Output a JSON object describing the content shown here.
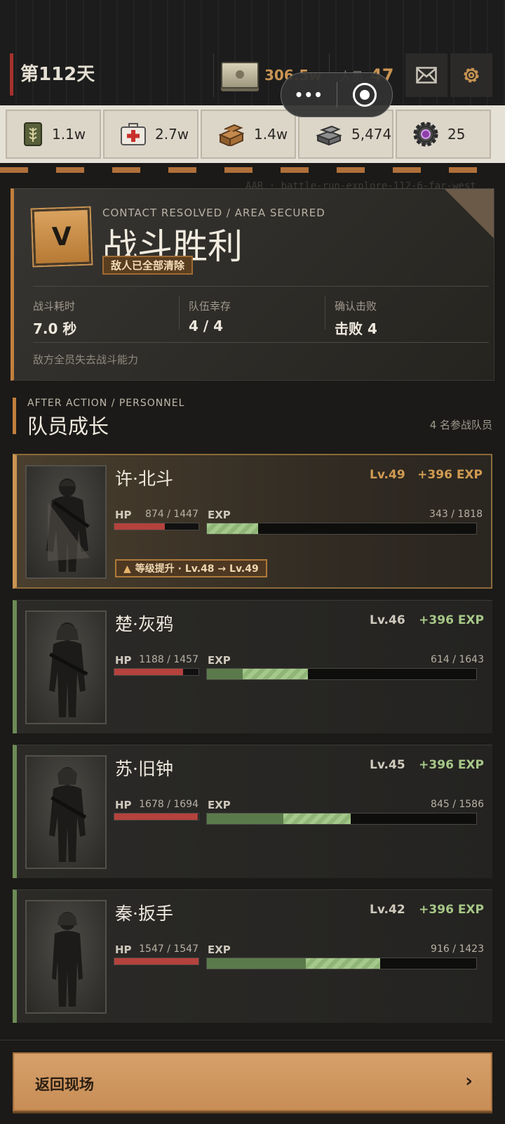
{
  "header": {
    "day": "第112天",
    "money": "306.5w",
    "personnel_label": "人员",
    "personnel_value": "47",
    "capsule_more": "•••"
  },
  "resources": [
    {
      "icon": "grain-can-icon",
      "value": "1.1w"
    },
    {
      "icon": "medkit-icon",
      "value": "2.7w"
    },
    {
      "icon": "wood-planks-icon",
      "value": "1.4w"
    },
    {
      "icon": "steel-ingots-icon",
      "value": "5,474"
    },
    {
      "icon": "gear-core-icon",
      "value": "25"
    }
  ],
  "log_ghost": "AAR · battle-run-explore-112-6-far-west",
  "victory": {
    "badge": "V",
    "subtitle_en": "CONTACT RESOLVED / AREA SECURED",
    "title": "战斗胜利",
    "tag": "敌人已全部清除",
    "stats": [
      {
        "label": "战斗耗时",
        "value": "7.0 秒"
      },
      {
        "label": "队伍幸存",
        "value": "4 / 4"
      },
      {
        "label": "确认击败",
        "value": "击败 4"
      }
    ],
    "note": "敌方全员失去战斗能力"
  },
  "personnel_section": {
    "subtitle_en": "AFTER ACTION / PERSONNEL",
    "title": "队员成长",
    "count": "4 名参战队员"
  },
  "squad": [
    {
      "name": "许·北斗",
      "level": "Lv.49",
      "gain": "+396 EXP",
      "hp_label": "HP",
      "hp": "874 / 1447",
      "hp_ratio": 0.604,
      "exp_label": "EXP",
      "exp": "343 / 1818",
      "exp_ratio": 0.189,
      "exp_gain_ratio": 0.189,
      "levelup": "等级提升 · Lv.48 → Lv.49"
    },
    {
      "name": "楚·灰鸦",
      "level": "Lv.46",
      "gain": "+396 EXP",
      "hp_label": "HP",
      "hp": "1188 / 1457",
      "hp_ratio": 0.815,
      "exp_label": "EXP",
      "exp": "614 / 1643",
      "exp_ratio": 0.374,
      "exp_gain_ratio": 0.241
    },
    {
      "name": "苏·旧钟",
      "level": "Lv.45",
      "gain": "+396 EXP",
      "hp_label": "HP",
      "hp": "1678 / 1694",
      "hp_ratio": 0.991,
      "exp_label": "EXP",
      "exp": "845 / 1586",
      "exp_ratio": 0.533,
      "exp_gain_ratio": 0.25
    },
    {
      "name": "秦·扳手",
      "level": "Lv.42",
      "gain": "+396 EXP",
      "hp_label": "HP",
      "hp": "1547 / 1547",
      "hp_ratio": 1.0,
      "exp_label": "EXP",
      "exp": "916 / 1423",
      "exp_ratio": 0.644,
      "exp_gain_ratio": 0.278
    }
  ],
  "footer": {
    "return_label": "返回现场",
    "arrow": "›"
  },
  "colors": {
    "accent": "#c99453",
    "hp": "#b5423d",
    "exp": "#5b7a4b",
    "exp_gain": "#a5c88b",
    "card_border_green": "#6c8b57"
  }
}
